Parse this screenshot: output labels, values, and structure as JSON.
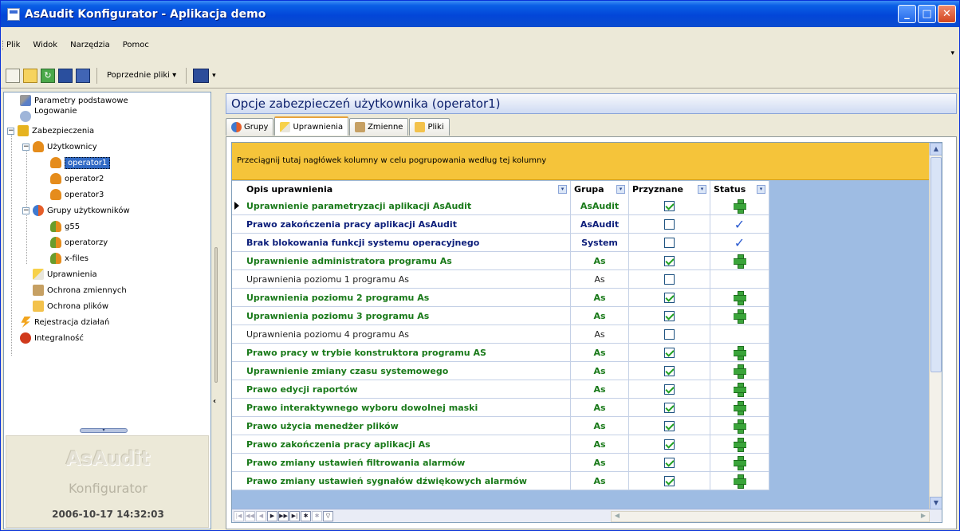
{
  "window": {
    "title": "AsAudit Konfigurator - Aplikacja demo"
  },
  "menu": {
    "items": [
      "Plik",
      "Widok",
      "Narzędzia",
      "Pomoc"
    ]
  },
  "toolbar": {
    "recent_files": "Poprzednie pliki ▾"
  },
  "tree": {
    "items": [
      "Parametry podstawowe",
      "Logowanie",
      "Zabezpieczenia",
      "Użytkownicy",
      "operator1",
      "operator2",
      "operator3",
      "Grupy użytkowników",
      "g55",
      "operatorzy",
      "x-files",
      "Uprawnienia",
      "Ochrona zmiennych",
      "Ochrona plików",
      "Rejestracja działań",
      "Integralność"
    ]
  },
  "brand": {
    "name": "AsAudit",
    "sub": "Konfigurator",
    "datetime": "2006-10-17 14:32:03"
  },
  "panel": {
    "title": "Opcje zabezpieczeń użytkownika (operator1)"
  },
  "tabs": [
    "Grupy",
    "Uprawnienia",
    "Zmienne",
    "Pliki"
  ],
  "grid": {
    "group_hint": "Przeciągnij tutaj nagłówek kolumny w celu pogrupowania według tej kolumny",
    "columns": [
      "Opis uprawnienia",
      "Grupa",
      "Przyznane",
      "Status"
    ],
    "rows": [
      {
        "desc": "Uprawnienie parametryzacji aplikacji AsAudit",
        "group": "AsAudit",
        "granted": true,
        "status": "plus",
        "style": "green"
      },
      {
        "desc": "Prawo zakończenia pracy aplikacji AsAudit",
        "group": "AsAudit",
        "granted": false,
        "status": "check",
        "style": "navy"
      },
      {
        "desc": "Brak blokowania funkcji systemu operacyjnego",
        "group": "System",
        "granted": false,
        "status": "check",
        "style": "navy"
      },
      {
        "desc": "Uprawnienie administratora programu As",
        "group": "As",
        "granted": true,
        "status": "plus",
        "style": "green"
      },
      {
        "desc": "Uprawnienia poziomu 1 programu As",
        "group": "As",
        "granted": false,
        "status": "",
        "style": "plain"
      },
      {
        "desc": "Uprawnienia poziomu 2 programu As",
        "group": "As",
        "granted": true,
        "status": "plus",
        "style": "green"
      },
      {
        "desc": "Uprawnienia poziomu 3 programu As",
        "group": "As",
        "granted": true,
        "status": "plus",
        "style": "green"
      },
      {
        "desc": "Uprawnienia poziomu 4 programu As",
        "group": "As",
        "granted": false,
        "status": "",
        "style": "plain"
      },
      {
        "desc": "Prawo pracy w trybie konstruktora programu AS",
        "group": "As",
        "granted": true,
        "status": "plus",
        "style": "green"
      },
      {
        "desc": "Uprawnienie zmiany czasu systemowego",
        "group": "As",
        "granted": true,
        "status": "plus",
        "style": "green"
      },
      {
        "desc": "Prawo edycji raportów",
        "group": "As",
        "granted": true,
        "status": "plus",
        "style": "green"
      },
      {
        "desc": "Prawo interaktywnego wyboru dowolnej maski",
        "group": "As",
        "granted": true,
        "status": "plus",
        "style": "green"
      },
      {
        "desc": "Prawo użycia menedżer plików",
        "group": "As",
        "granted": true,
        "status": "plus",
        "style": "green"
      },
      {
        "desc": "Prawo zakończenia pracy aplikacji As",
        "group": "As",
        "granted": true,
        "status": "plus",
        "style": "green"
      },
      {
        "desc": "Prawo zmiany ustawień filtrowania alarmów",
        "group": "As",
        "granted": true,
        "status": "plus",
        "style": "green"
      },
      {
        "desc": "Prawo zmiany ustawień sygnałów dźwiękowych alarmów",
        "group": "As",
        "granted": true,
        "status": "plus",
        "style": "green"
      }
    ]
  }
}
